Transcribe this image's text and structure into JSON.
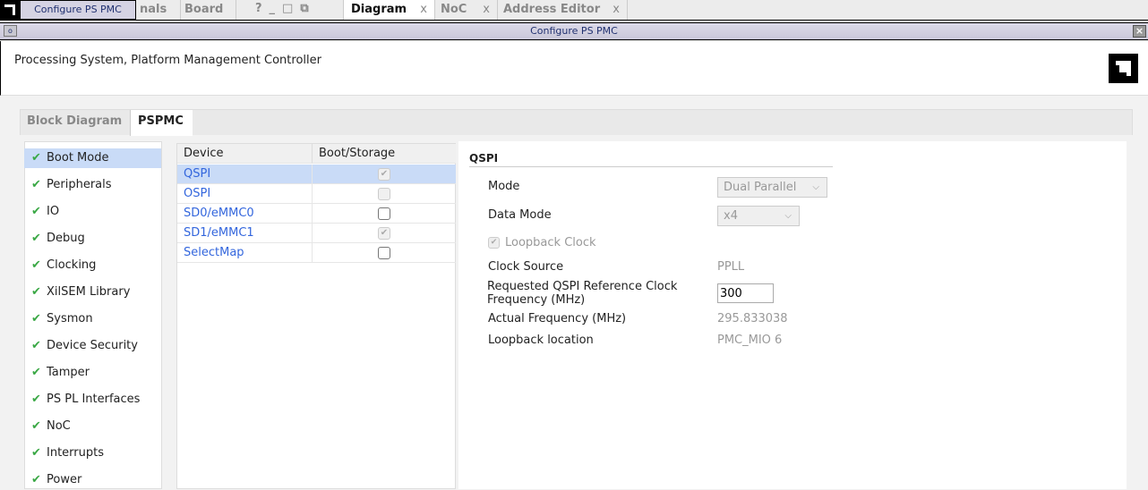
{
  "topbar": {
    "tooltip": "Configure PS PMC",
    "tabs": [
      "nals",
      "Board"
    ],
    "icons": [
      "?",
      "_",
      "□",
      "⧉"
    ],
    "doc_tabs": [
      {
        "label": "Diagram",
        "close": "x"
      },
      {
        "label": "NoC",
        "close": "x"
      },
      {
        "label": "Address Editor",
        "close": "x"
      }
    ]
  },
  "titlebar": {
    "title": "Configure PS PMC",
    "close": "×",
    "menu": "o"
  },
  "header": {
    "description": "Processing System, Platform Management Controller"
  },
  "tabs": [
    {
      "label": "Block Diagram"
    },
    {
      "label": "PSPMC"
    }
  ],
  "nav": {
    "check": "✔",
    "items": [
      "Boot Mode",
      "Peripherals",
      "IO",
      "Debug",
      "Clocking",
      "XilSEM Library",
      "Sysmon",
      "Device Security",
      "Tamper",
      "PS PL Interfaces",
      "NoC",
      "Interrupts",
      "Power"
    ]
  },
  "table": {
    "headers": [
      "Device",
      "Boot/Storage"
    ],
    "check": "✔",
    "rows": [
      {
        "device": "QSPI",
        "checked": true,
        "disabled": true
      },
      {
        "device": "OSPI",
        "checked": false,
        "disabled": true
      },
      {
        "device": "SD0/eMMC0",
        "checked": false,
        "disabled": false
      },
      {
        "device": "SD1/eMMC1",
        "checked": true,
        "disabled": true
      },
      {
        "device": "SelectMap",
        "checked": false,
        "disabled": false
      }
    ]
  },
  "qspi": {
    "title": "QSPI",
    "mode_label": "Mode",
    "mode_value": "Dual Parallel",
    "data_mode_label": "Data Mode",
    "data_mode_value": "x4",
    "loopback_label": "Loopback Clock",
    "clock_source_label": "Clock Source",
    "clock_source_value": "PPLL",
    "req_freq_label_1": "Requested QSPI Reference Clock",
    "req_freq_label_2": "Frequency (MHz)",
    "req_freq_value": "300",
    "actual_freq_label": "Actual Frequency (MHz)",
    "actual_freq_value": "295.833038",
    "loopback_loc_label": "Loopback location",
    "loopback_loc_value": "PMC_MIO 6",
    "chevron": "⌵"
  }
}
